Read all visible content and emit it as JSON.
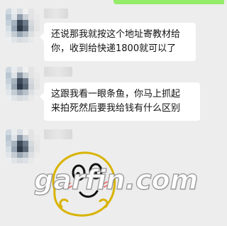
{
  "messages": [
    {
      "sender": "contact",
      "lines": [
        "还说那我就按这个地址寄教材给",
        "你，收到给快递1800就可以了"
      ]
    },
    {
      "sender": "contact",
      "lines": [
        "这跟我看一眼条鱼，你马上抓起",
        "来拍死然后要我给钱有什么区别"
      ]
    },
    {
      "sender": "contact",
      "type": "sticker",
      "sticker": "face-sticker"
    }
  ],
  "watermark": "garfin.com",
  "colors": {
    "background": "#ededed",
    "bubble": "#ffffff",
    "self_bubble": "#95ec69",
    "sticker_stroke": "#d9b300"
  }
}
